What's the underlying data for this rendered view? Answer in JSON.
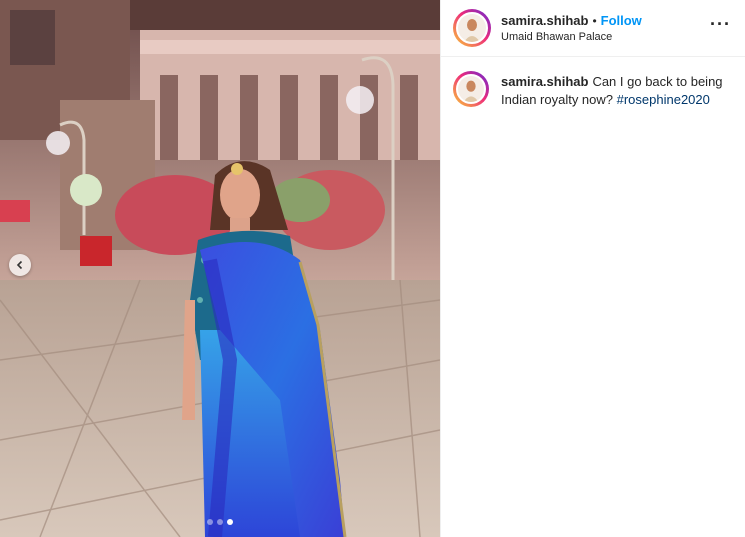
{
  "post": {
    "username": "samira.shihab",
    "separator": "•",
    "follow_label": "Follow",
    "location": "Umaid Bhawan Palace",
    "more_icon": "more-horizontal-icon",
    "caption": {
      "username": "samira.shihab",
      "text": "Can I go back to being Indian royalty now? ",
      "hashtag": "#rosephine2020"
    },
    "carousel": {
      "current_index": 3,
      "total": 3
    }
  },
  "colors": {
    "follow": "#0095f6",
    "hashtag": "#00376b",
    "ring_start": "#f9ce34",
    "ring_end": "#6228d7"
  }
}
